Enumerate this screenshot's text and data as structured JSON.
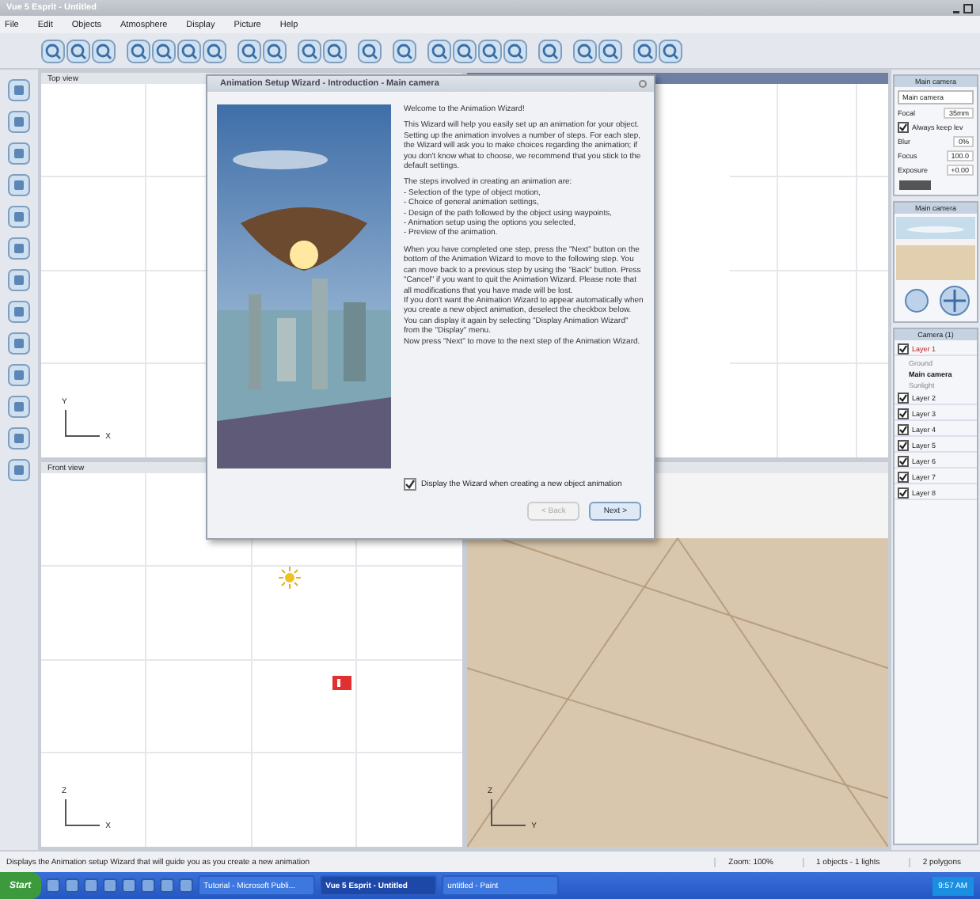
{
  "window": {
    "title": "Vue 5 Esprit - Untitled"
  },
  "menu": [
    "File",
    "Edit",
    "Objects",
    "Atmosphere",
    "Display",
    "Picture",
    "Help"
  ],
  "viewports": [
    {
      "label": "Top view",
      "axes": [
        "Y",
        "X"
      ],
      "kind": "top"
    },
    {
      "kind": "side"
    },
    {
      "label": "Front view",
      "axes": [
        "Z",
        "X"
      ],
      "kind": "front"
    },
    {
      "axes": [
        "Z",
        "Y"
      ],
      "kind": "perspective"
    }
  ],
  "dialog": {
    "title": "Animation Setup Wizard - Introduction - Main camera",
    "paragraphs": [
      "Welcome to the Animation Wizard!",
      "This Wizard will help you easily set up an animation for your object. Setting up the animation involves a number of steps. For each step, the Wizard will ask you to make choices regarding the animation; if you don't know what to choose, we recommend that you stick to the default settings.",
      "The steps involved in creating an animation are:\n- Selection of the type of object motion,\n- Choice of general animation settings,\n- Design of the path followed by the object using waypoints,\n- Animation setup using the options you selected,\n- Preview of the animation.",
      "When you have completed one step, press the \"Next\" button on the bottom of the Animation Wizard to move to the following step. You can move back to a previous step by using the \"Back\" button. Press \"Cancel\" if you want to quit the Animation Wizard. Please note that all modifications that you have made will be lost.\nIf you don't want the Animation Wizard to appear automatically when you create a new object animation, deselect the checkbox below. You can display it again by selecting \"Display Animation Wizard\" from the \"Display\" menu.\nNow press \"Next\" to move to the next step of the Animation Wizard."
    ],
    "checkbox": {
      "label": "Display the Wizard when creating a new object animation",
      "checked": true
    },
    "buttons": [
      {
        "label": "< Back",
        "disabled": true
      },
      {
        "label": "Next >",
        "disabled": false
      }
    ]
  },
  "camera_panel": {
    "title": "Main camera",
    "dropdown": "Main camera",
    "fields": [
      {
        "label": "Focal",
        "value": "35mm"
      }
    ],
    "keep_level": {
      "label": "Always keep lev",
      "checked": true
    },
    "settings": [
      {
        "label": "Blur",
        "value": "0%"
      },
      {
        "label": "Focus",
        "value": "100.0"
      },
      {
        "label": "Exposure",
        "value": "+0.00"
      }
    ]
  },
  "preview_panel": {
    "title": "Main camera"
  },
  "layers_panel": {
    "title": "Camera (1)",
    "layers": [
      {
        "label": "Layer 1",
        "checked": true,
        "selected": true,
        "children": [
          {
            "label": "Ground",
            "selected": false
          },
          {
            "label": "Main camera",
            "selected": true
          },
          {
            "label": "Sunlight",
            "selected": false
          }
        ]
      },
      {
        "label": "Layer 2",
        "checked": true,
        "selected": false
      },
      {
        "label": "Layer 3",
        "checked": true,
        "selected": false
      },
      {
        "label": "Layer 4",
        "checked": true,
        "selected": false
      },
      {
        "label": "Layer 5",
        "checked": true,
        "selected": false
      },
      {
        "label": "Layer 6",
        "checked": true,
        "selected": false
      },
      {
        "label": "Layer 7",
        "checked": true,
        "selected": false
      },
      {
        "label": "Layer 8",
        "checked": true,
        "selected": false
      }
    ]
  },
  "status_bar": {
    "message": "Displays the Animation setup Wizard that will guide you as you create a new animation",
    "zoom": "Zoom: 100%",
    "counts": "1 objects - 1 lights",
    "polygons": "2 polygons"
  },
  "taskbar": {
    "start": "Start",
    "tasks": [
      {
        "label": "Tutorial - Microsoft Publi...",
        "selected": false
      },
      {
        "label": "Vue 5 Esprit - Untitled",
        "selected": true
      },
      {
        "label": "untitled - Paint",
        "selected": false
      }
    ],
    "clock": "9:57 AM"
  }
}
